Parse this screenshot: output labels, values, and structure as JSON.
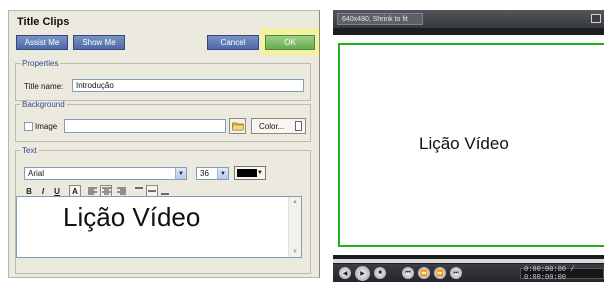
{
  "dialog": {
    "title": "Title Clips",
    "buttons": {
      "assist_me": "Assist Me",
      "show_me": "Show Me",
      "cancel": "Cancel",
      "ok": "OK"
    }
  },
  "properties": {
    "legend": "Properties",
    "title_label": "Title name:",
    "title_value": "Introdução"
  },
  "background": {
    "legend": "Background",
    "image_label": "Image",
    "image_checked": false,
    "image_path": "",
    "color_button": "Color..."
  },
  "text_section": {
    "legend": "Text",
    "font": "Arial",
    "size": "36",
    "color": "#000000",
    "format_buttons": [
      "B",
      "I",
      "U",
      "A",
      "align-left",
      "align-center",
      "align-right",
      "valign-top",
      "valign-middle",
      "valign-bottom"
    ],
    "content": "Lição Vídeo"
  },
  "preview": {
    "resolution": "640x480, Shrink to fit",
    "text": "Lição Vídeo",
    "time": "0:00:00:00 / 0:00:00:00",
    "frame_color": "#20b020"
  }
}
